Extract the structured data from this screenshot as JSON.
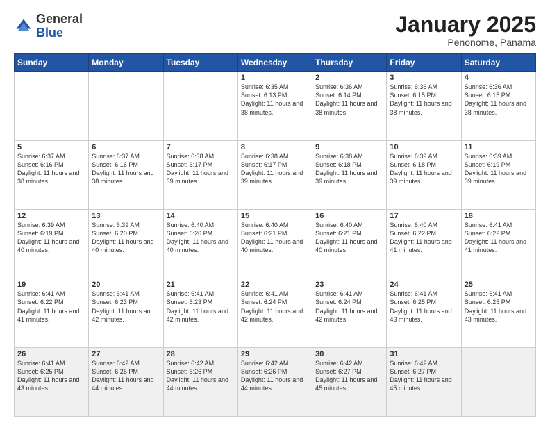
{
  "header": {
    "logo_general": "General",
    "logo_blue": "Blue",
    "month_title": "January 2025",
    "subtitle": "Penonome, Panama"
  },
  "columns": [
    "Sunday",
    "Monday",
    "Tuesday",
    "Wednesday",
    "Thursday",
    "Friday",
    "Saturday"
  ],
  "weeks": [
    [
      {
        "day": "",
        "info": ""
      },
      {
        "day": "",
        "info": ""
      },
      {
        "day": "",
        "info": ""
      },
      {
        "day": "1",
        "info": "Sunrise: 6:35 AM\nSunset: 6:13 PM\nDaylight: 11 hours and 38 minutes."
      },
      {
        "day": "2",
        "info": "Sunrise: 6:36 AM\nSunset: 6:14 PM\nDaylight: 11 hours and 38 minutes."
      },
      {
        "day": "3",
        "info": "Sunrise: 6:36 AM\nSunset: 6:15 PM\nDaylight: 11 hours and 38 minutes."
      },
      {
        "day": "4",
        "info": "Sunrise: 6:36 AM\nSunset: 6:15 PM\nDaylight: 11 hours and 38 minutes."
      }
    ],
    [
      {
        "day": "5",
        "info": "Sunrise: 6:37 AM\nSunset: 6:16 PM\nDaylight: 11 hours and 38 minutes."
      },
      {
        "day": "6",
        "info": "Sunrise: 6:37 AM\nSunset: 6:16 PM\nDaylight: 11 hours and 38 minutes."
      },
      {
        "day": "7",
        "info": "Sunrise: 6:38 AM\nSunset: 6:17 PM\nDaylight: 11 hours and 39 minutes."
      },
      {
        "day": "8",
        "info": "Sunrise: 6:38 AM\nSunset: 6:17 PM\nDaylight: 11 hours and 39 minutes."
      },
      {
        "day": "9",
        "info": "Sunrise: 6:38 AM\nSunset: 6:18 PM\nDaylight: 11 hours and 39 minutes."
      },
      {
        "day": "10",
        "info": "Sunrise: 6:39 AM\nSunset: 6:18 PM\nDaylight: 11 hours and 39 minutes."
      },
      {
        "day": "11",
        "info": "Sunrise: 6:39 AM\nSunset: 6:19 PM\nDaylight: 11 hours and 39 minutes."
      }
    ],
    [
      {
        "day": "12",
        "info": "Sunrise: 6:39 AM\nSunset: 6:19 PM\nDaylight: 11 hours and 40 minutes."
      },
      {
        "day": "13",
        "info": "Sunrise: 6:39 AM\nSunset: 6:20 PM\nDaylight: 11 hours and 40 minutes."
      },
      {
        "day": "14",
        "info": "Sunrise: 6:40 AM\nSunset: 6:20 PM\nDaylight: 11 hours and 40 minutes."
      },
      {
        "day": "15",
        "info": "Sunrise: 6:40 AM\nSunset: 6:21 PM\nDaylight: 11 hours and 40 minutes."
      },
      {
        "day": "16",
        "info": "Sunrise: 6:40 AM\nSunset: 6:21 PM\nDaylight: 11 hours and 40 minutes."
      },
      {
        "day": "17",
        "info": "Sunrise: 6:40 AM\nSunset: 6:22 PM\nDaylight: 11 hours and 41 minutes."
      },
      {
        "day": "18",
        "info": "Sunrise: 6:41 AM\nSunset: 6:22 PM\nDaylight: 11 hours and 41 minutes."
      }
    ],
    [
      {
        "day": "19",
        "info": "Sunrise: 6:41 AM\nSunset: 6:22 PM\nDaylight: 11 hours and 41 minutes."
      },
      {
        "day": "20",
        "info": "Sunrise: 6:41 AM\nSunset: 6:23 PM\nDaylight: 11 hours and 42 minutes."
      },
      {
        "day": "21",
        "info": "Sunrise: 6:41 AM\nSunset: 6:23 PM\nDaylight: 11 hours and 42 minutes."
      },
      {
        "day": "22",
        "info": "Sunrise: 6:41 AM\nSunset: 6:24 PM\nDaylight: 11 hours and 42 minutes."
      },
      {
        "day": "23",
        "info": "Sunrise: 6:41 AM\nSunset: 6:24 PM\nDaylight: 11 hours and 42 minutes."
      },
      {
        "day": "24",
        "info": "Sunrise: 6:41 AM\nSunset: 6:25 PM\nDaylight: 11 hours and 43 minutes."
      },
      {
        "day": "25",
        "info": "Sunrise: 6:41 AM\nSunset: 6:25 PM\nDaylight: 11 hours and 43 minutes."
      }
    ],
    [
      {
        "day": "26",
        "info": "Sunrise: 6:41 AM\nSunset: 6:25 PM\nDaylight: 11 hours and 43 minutes."
      },
      {
        "day": "27",
        "info": "Sunrise: 6:42 AM\nSunset: 6:26 PM\nDaylight: 11 hours and 44 minutes."
      },
      {
        "day": "28",
        "info": "Sunrise: 6:42 AM\nSunset: 6:26 PM\nDaylight: 11 hours and 44 minutes."
      },
      {
        "day": "29",
        "info": "Sunrise: 6:42 AM\nSunset: 6:26 PM\nDaylight: 11 hours and 44 minutes."
      },
      {
        "day": "30",
        "info": "Sunrise: 6:42 AM\nSunset: 6:27 PM\nDaylight: 11 hours and 45 minutes."
      },
      {
        "day": "31",
        "info": "Sunrise: 6:42 AM\nSunset: 6:27 PM\nDaylight: 11 hours and 45 minutes."
      },
      {
        "day": "",
        "info": ""
      }
    ]
  ]
}
